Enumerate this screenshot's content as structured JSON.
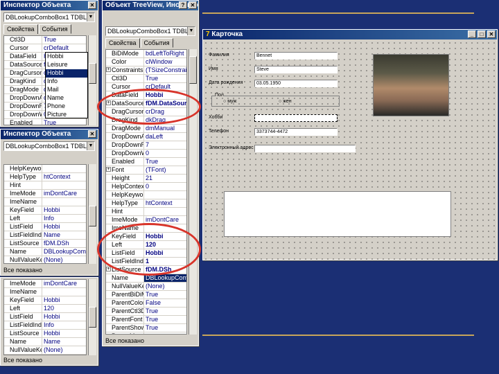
{
  "win1": {
    "title": "Инспектор Объекта",
    "combo": "DBLookupComboBox1 TDBLookupComboBox",
    "tabs": [
      "Свойства",
      "События"
    ],
    "rows": [
      {
        "k": "Ctl3D",
        "v": "True"
      },
      {
        "k": "Cursor",
        "v": "crDefault"
      },
      {
        "k": "DataField",
        "v": "Hobbi"
      },
      {
        "k": "DataSource",
        "v": "fDM.DataSource1"
      },
      {
        "k": "DragCursor",
        "v": "crDrag"
      },
      {
        "k": "DragKind",
        "v": "dkDrag"
      },
      {
        "k": "DragMode",
        "v": "dmManual"
      },
      {
        "k": "DropDownAlign",
        "v": "daLeft"
      },
      {
        "k": "DropDownRows",
        "v": "7"
      },
      {
        "k": "DropDownWidth",
        "v": "0"
      },
      {
        "k": "Enabled",
        "v": "True"
      }
    ],
    "dropdown": [
      "Hobbi",
      "Leisure",
      "Hobbi",
      "Info",
      "Mail",
      "Name",
      "Phone",
      "Picture"
    ]
  },
  "win2": {
    "title": "Инспектор Объекта",
    "combo": "DBLookupComboBox1 TDBLookupComboBox",
    "rows": [
      {
        "k": "HelpKeyword",
        "v": ""
      },
      {
        "k": "HelpType",
        "v": "htContext"
      },
      {
        "k": "Hint",
        "v": ""
      },
      {
        "k": "ImeMode",
        "v": "imDontCare"
      },
      {
        "k": "ImeName",
        "v": ""
      },
      {
        "k": "KeyField",
        "v": "Hobbi"
      },
      {
        "k": "Left",
        "v": "Info"
      },
      {
        "k": "ListField",
        "v": "Hobbi"
      },
      {
        "k": "ListFieldIndex",
        "v": "Name"
      },
      {
        "k": "ListSource",
        "v": "fDM.DSh"
      },
      {
        "k": "Name",
        "v": "DBLookupComboBox1"
      },
      {
        "k": "NullValueKey",
        "v": "(None)"
      }
    ],
    "status": "Все показано"
  },
  "win3": {
    "rows": [
      {
        "k": "ImeMode",
        "v": "imDontCare"
      },
      {
        "k": "ImeName",
        "v": ""
      },
      {
        "k": "KeyField",
        "v": "Hobbi"
      },
      {
        "k": "Left",
        "v": "120"
      },
      {
        "k": "ListField",
        "v": "Hobbi"
      },
      {
        "k": "ListFieldIndex",
        "v": "Info"
      },
      {
        "k": "ListSource",
        "v": "Hobbi"
      },
      {
        "k": "Name",
        "v": "Name"
      },
      {
        "k": "NullValueKey",
        "v": "(None)"
      }
    ],
    "status": "Все показано"
  },
  "win4": {
    "title": "Объект TreeView, Инспектор Объекта",
    "combo": "DBLookupComboBox1 TDBLookupComboBox",
    "tabs": [
      "Свойства",
      "События"
    ],
    "rows": [
      {
        "k": "BiDiMode",
        "v": "bdLeftToRight"
      },
      {
        "k": "Color",
        "v": "clWindow"
      },
      {
        "k": "Constraints",
        "v": "(TSizeConstraints)",
        "plus": true
      },
      {
        "k": "Ctl3D",
        "v": "True"
      },
      {
        "k": "Cursor",
        "v": "crDefault"
      },
      {
        "k": "DataField",
        "v": "Hobbi",
        "b": true
      },
      {
        "k": "DataSource",
        "v": "fDM.DataSource1",
        "b": true,
        "plus": true
      },
      {
        "k": "DragCursor",
        "v": "crDrag"
      },
      {
        "k": "DragKind",
        "v": "dkDrag"
      },
      {
        "k": "DragMode",
        "v": "dmManual"
      },
      {
        "k": "DropDownAlign",
        "v": "daLeft"
      },
      {
        "k": "DropDownRows",
        "v": "7"
      },
      {
        "k": "DropDownWidth",
        "v": "0"
      },
      {
        "k": "Enabled",
        "v": "True"
      },
      {
        "k": "Font",
        "v": "(TFont)",
        "plus": true
      },
      {
        "k": "Height",
        "v": "21"
      },
      {
        "k": "HelpContext",
        "v": "0"
      },
      {
        "k": "HelpKeyword",
        "v": ""
      },
      {
        "k": "HelpType",
        "v": "htContext"
      },
      {
        "k": "Hint",
        "v": ""
      },
      {
        "k": "ImeMode",
        "v": "imDontCare"
      },
      {
        "k": "ImeName",
        "v": ""
      },
      {
        "k": "KeyField",
        "v": "Hobbi",
        "b": true
      },
      {
        "k": "Left",
        "v": "120",
        "b": true
      },
      {
        "k": "ListField",
        "v": "Hobbi",
        "b": true
      },
      {
        "k": "ListFieldIndex",
        "v": "1",
        "b": true
      },
      {
        "k": "ListSource",
        "v": "fDM.DSh",
        "b": true,
        "plus": true
      },
      {
        "k": "Name",
        "v": "DBLookupComboBox1",
        "sel": true
      },
      {
        "k": "NullValueKey",
        "v": "(None)"
      },
      {
        "k": "ParentBiDiMode",
        "v": "True"
      },
      {
        "k": "ParentColor",
        "v": "False"
      },
      {
        "k": "ParentCtl3D",
        "v": "True"
      },
      {
        "k": "ParentFont",
        "v": "True"
      },
      {
        "k": "ParentShowHint",
        "v": "True"
      },
      {
        "k": "PopupMenu",
        "v": ""
      }
    ],
    "status": "Все показано"
  },
  "form": {
    "title": "Карточка",
    "labels": {
      "name": "Фамилия",
      "first": "Имя",
      "dob": "Дата рождения",
      "gender": "Пол",
      "male": "муж",
      "female": "жен",
      "hobby": "Хобби",
      "phone": "Телефон",
      "email": "Электронный адрес"
    },
    "values": {
      "name": "Bennet",
      "first": "Steve",
      "dob": "03.05.1950",
      "phone": "3373744-4472"
    }
  }
}
